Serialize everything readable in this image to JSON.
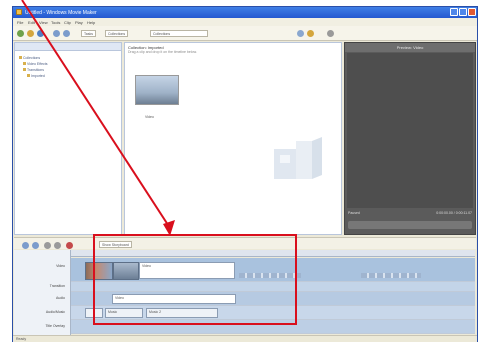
{
  "window": {
    "title": "Untitled - Windows Movie Maker"
  },
  "menu": [
    "File",
    "Edit",
    "View",
    "Tools",
    "Clip",
    "Play",
    "Help"
  ],
  "toolbar": {
    "tasks_label": "Tasks",
    "collections_label": "Collections",
    "collection_select": "Collections"
  },
  "tasks": {
    "items": [
      "Collections",
      "Video Effects",
      "Transitions",
      "Imported"
    ]
  },
  "collection": {
    "heading": "Collection: Imported",
    "subheading": "Drag a clip and drop it on the timeline below.",
    "clip_label": "Video"
  },
  "monitor": {
    "title": "Preview: Video",
    "status": "Paused",
    "time": "0:00:00.00 / 0:00:11.07"
  },
  "timeline": {
    "toolbar_label": "Show Storyboard",
    "tracks": [
      "Video",
      "Transition",
      "Audio",
      "Audio/Music",
      "Title Overlay"
    ],
    "video_clip_label": "Video",
    "audio_clip_label": "Video",
    "music_clip_labels": [
      "Music",
      "Music 2"
    ]
  },
  "statusbar": {
    "text": "Ready"
  },
  "colors": {
    "annotation": "#d90f1d",
    "title_bar": "#2458d0"
  }
}
